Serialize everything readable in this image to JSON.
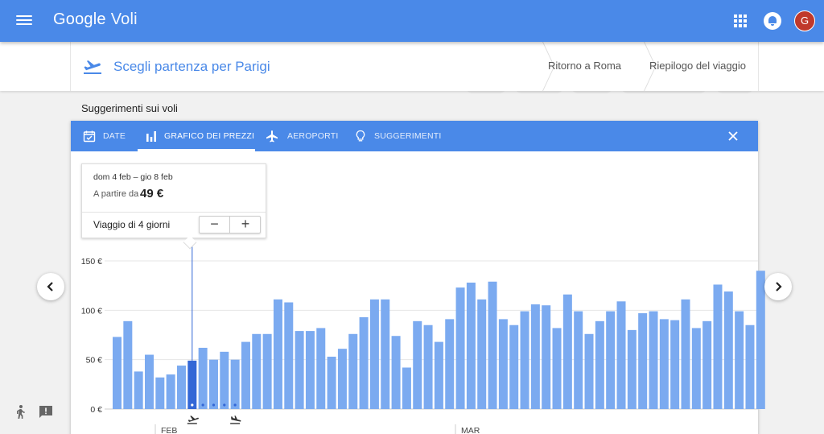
{
  "appbar": {
    "brand_google": "Google",
    "brand_voli": "Voli",
    "avatar_letter": "G"
  },
  "steps": {
    "current": "Scegli partenza per Parigi",
    "return": "Ritorno a Roma",
    "summary": "Riepilogo del viaggio"
  },
  "suggestions_title": "Suggerimenti sui voli",
  "tabs": [
    {
      "label": "DATE",
      "icon": "calendar-check-icon"
    },
    {
      "label": "GRAFICO DEI PREZZI",
      "icon": "bar-chart-icon",
      "active": true
    },
    {
      "label": "AEROPORTI",
      "icon": "airplane-icon"
    },
    {
      "label": "SUGGERIMENTI",
      "icon": "lightbulb-icon"
    }
  ],
  "tooltip": {
    "dates": "dom 4 feb – gio 8 feb",
    "from_label": "A partire da",
    "price": "49 €",
    "trip_length": "Viaggio di 4 giorni",
    "minus": "−",
    "plus": "+"
  },
  "colors": {
    "primary": "#4a89e8",
    "bar": "#7baaf0",
    "bar_selected": "#3367d6"
  },
  "chart_data": {
    "type": "bar",
    "yticks": [
      "150 €",
      "100 €",
      "50 €",
      "0 €"
    ],
    "ytick_values": [
      150,
      100,
      50,
      0
    ],
    "ylim": [
      0,
      150
    ],
    "xticks": [
      "FEB",
      "MAR"
    ],
    "selected_index": 7,
    "values": [
      73,
      89,
      38,
      55,
      32,
      35,
      44,
      49,
      62,
      50,
      58,
      50,
      68,
      76,
      76,
      111,
      108,
      79,
      79,
      82,
      53,
      61,
      76,
      93,
      111,
      111,
      74,
      42,
      89,
      85,
      68,
      91,
      123,
      128,
      111,
      129,
      91,
      85,
      99,
      106,
      105,
      82,
      116,
      99,
      76,
      89,
      99,
      109,
      80,
      97,
      99,
      91,
      90,
      111,
      82,
      89,
      126,
      119,
      99,
      85,
      140
    ]
  }
}
